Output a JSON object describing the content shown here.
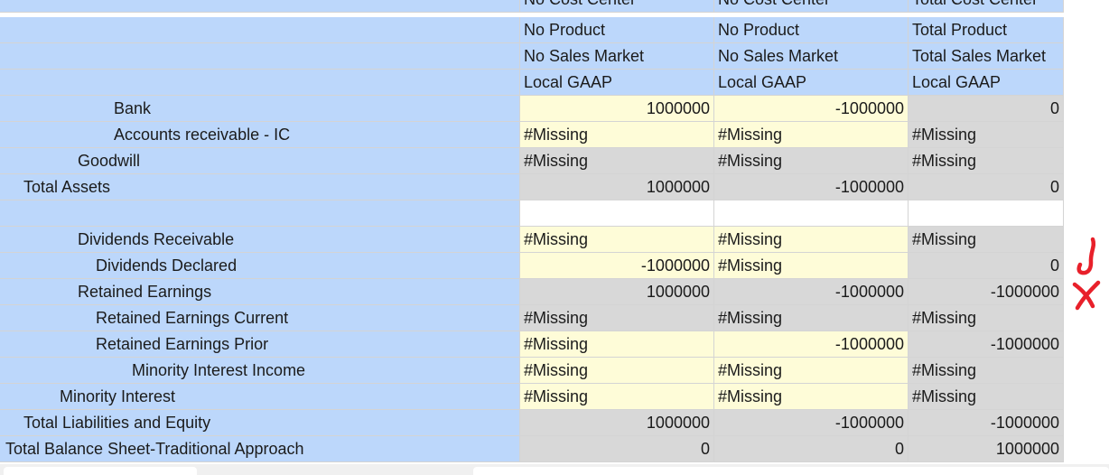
{
  "header_rows": [
    {
      "label": "",
      "c1": "No Cost Center",
      "c2": "No Cost Center",
      "c3": "Total Cost Center"
    },
    {
      "label": "",
      "c1": "No Product",
      "c2": "No Product",
      "c3": "Total Product"
    },
    {
      "label": "",
      "c1": "No Sales Market",
      "c2": "No Sales Market",
      "c3": "Total Sales Market"
    },
    {
      "label": "",
      "c1": "Local GAAP",
      "c2": "Local GAAP",
      "c3": "Local GAAP"
    }
  ],
  "data_rows": [
    {
      "label": "Bank",
      "c1": "1000000",
      "c2": "-1000000",
      "c3": "0"
    },
    {
      "label": "Accounts receivable - IC",
      "c1": "#Missing",
      "c2": "#Missing",
      "c3": "#Missing"
    },
    {
      "label": "Goodwill",
      "c1": "#Missing",
      "c2": "#Missing",
      "c3": "#Missing"
    },
    {
      "label": "Total Assets",
      "c1": "1000000",
      "c2": "-1000000",
      "c3": "0"
    },
    {
      "label": "",
      "c1": "",
      "c2": "",
      "c3": ""
    },
    {
      "label": "Dividends Receivable",
      "c1": "#Missing",
      "c2": "#Missing",
      "c3": "#Missing"
    },
    {
      "label": "Dividends Declared",
      "c1": "-1000000",
      "c2": "#Missing",
      "c3": "0"
    },
    {
      "label": "Retained Earnings",
      "c1": "1000000",
      "c2": "-1000000",
      "c3": "-1000000"
    },
    {
      "label": "Retained Earnings Current",
      "c1": "#Missing",
      "c2": "#Missing",
      "c3": "#Missing"
    },
    {
      "label": "Retained Earnings Prior",
      "c1": "#Missing",
      "c2": "-1000000",
      "c3": "-1000000"
    },
    {
      "label": "Minority Interest Income",
      "c1": "#Missing",
      "c2": "#Missing",
      "c3": "#Missing"
    },
    {
      "label": "Minority Interest",
      "c1": "#Missing",
      "c2": "#Missing",
      "c3": "#Missing"
    },
    {
      "label": "Total Liabilities and Equity",
      "c1": "1000000",
      "c2": "-1000000",
      "c3": "-1000000"
    },
    {
      "label": "Total Balance Sheet-Traditional Approach",
      "c1": "0",
      "c2": "0",
      "c3": "1000000"
    }
  ],
  "colors": {
    "label_bg": "#bcd7fb",
    "input_bg": "#fefcd8",
    "calc_bg": "#d8d8d8",
    "annotation": "#e8202a"
  },
  "annotations": [
    "checkmark-icon",
    "cross-icon"
  ]
}
